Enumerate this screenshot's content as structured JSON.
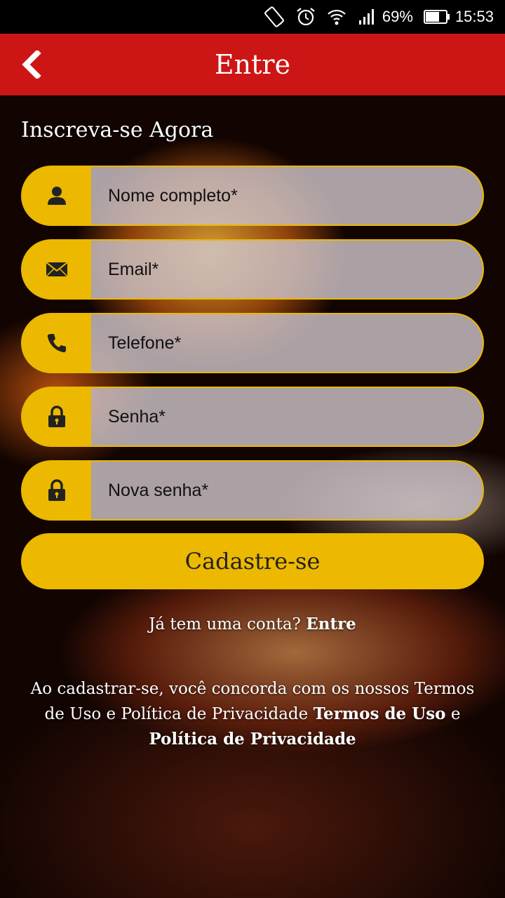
{
  "status_bar": {
    "battery_percent": "69%",
    "time": "15:53"
  },
  "header": {
    "title": "Entre"
  },
  "form": {
    "heading": "Inscreva-se Agora",
    "fields": [
      {
        "placeholder": "Nome completo*",
        "icon": "user-icon"
      },
      {
        "placeholder": "Email*",
        "icon": "mail-icon"
      },
      {
        "placeholder": "Telefone*",
        "icon": "phone-icon"
      },
      {
        "placeholder": "Senha*",
        "icon": "lock-icon"
      },
      {
        "placeholder": "Nova senha*",
        "icon": "lock-icon"
      }
    ],
    "submit_label": "Cadastre-se"
  },
  "login_prompt": {
    "text": "Já tem uma conta?",
    "link": "Entre"
  },
  "terms": {
    "text": "Ao cadastrar-se, você concorda com os nossos Termos de Uso e Política de Privacidade",
    "link_terms": "Termos de Uso",
    "connector": "e",
    "link_privacy": "Política de Privacidade"
  },
  "colors": {
    "app_bar": "#cc1616",
    "accent": "#ecb900"
  }
}
